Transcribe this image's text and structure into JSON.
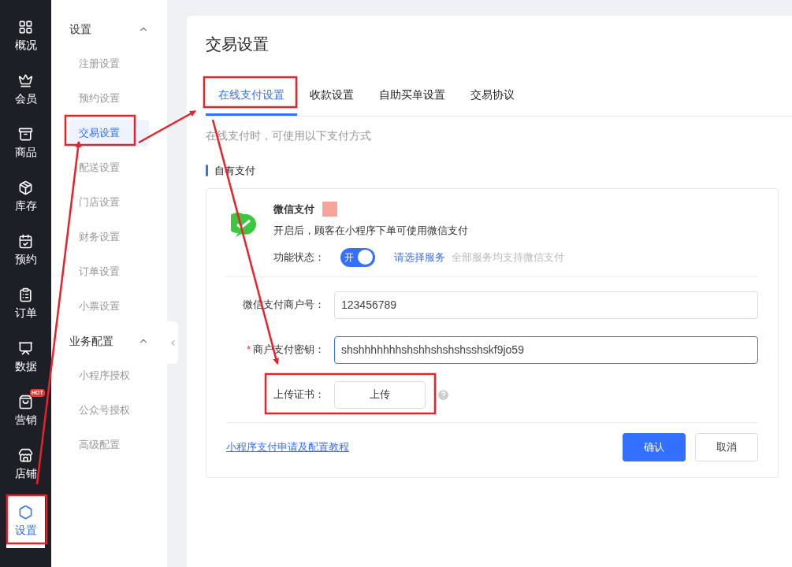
{
  "nav": [
    {
      "label": "概况",
      "selected": false
    },
    {
      "label": "会员",
      "selected": false
    },
    {
      "label": "商品",
      "selected": false
    },
    {
      "label": "库存",
      "selected": false
    },
    {
      "label": "预约",
      "selected": false
    },
    {
      "label": "订单",
      "selected": false
    },
    {
      "label": "数据",
      "selected": false
    },
    {
      "label": "营销",
      "selected": false,
      "badge": "HOT"
    },
    {
      "label": "店铺",
      "selected": false
    },
    {
      "label": "设置",
      "selected": true
    }
  ],
  "submenu": [
    {
      "title": "设置",
      "expanded": true,
      "items": [
        {
          "label": "注册设置",
          "selected": false
        },
        {
          "label": "预约设置",
          "selected": false
        },
        {
          "label": "交易设置",
          "selected": true
        },
        {
          "label": "配送设置",
          "selected": false
        },
        {
          "label": "门店设置",
          "selected": false
        },
        {
          "label": "财务设置",
          "selected": false
        },
        {
          "label": "订单设置",
          "selected": false
        },
        {
          "label": "小票设置",
          "selected": false
        }
      ]
    },
    {
      "title": "业务配置",
      "expanded": true,
      "items": [
        {
          "label": "小程序授权",
          "selected": false
        },
        {
          "label": "公众号授权",
          "selected": false
        },
        {
          "label": "高级配置",
          "selected": false
        }
      ]
    }
  ],
  "page": {
    "title": "交易设置",
    "tabs": [
      {
        "label": "在线支付设置",
        "selected": true
      },
      {
        "label": "收款设置",
        "selected": false
      },
      {
        "label": "自助买单设置",
        "selected": false
      },
      {
        "label": "交易协议",
        "selected": false
      }
    ],
    "description": "在线支付时，可使用以下支付方式",
    "section_title": "自有支付",
    "payment": {
      "name": "微信支付",
      "description": "开启后，顾客在小程序下单可使用微信支付",
      "status_label": "功能状态：",
      "switch": {
        "on": true,
        "label": "开"
      },
      "service_link": "请选择服务",
      "service_note": "全部服务均支持微信支付"
    },
    "fields": [
      {
        "kind": "input",
        "label": "微信支付商户号：",
        "value": "123456789",
        "focused": false
      },
      {
        "kind": "input",
        "label": "商户支付密钥：",
        "required_mark": "*",
        "value": "shshhhhhhhshshhshshshsshskf9jo59",
        "focused": true
      },
      {
        "kind": "upload",
        "label": "上传证书：",
        "value": "上传"
      }
    ],
    "tutorial_link": "小程序支付申请及配置教程",
    "buttons": [
      {
        "label": "确认",
        "kind": "primary"
      },
      {
        "label": "取消",
        "kind": "default"
      }
    ]
  }
}
